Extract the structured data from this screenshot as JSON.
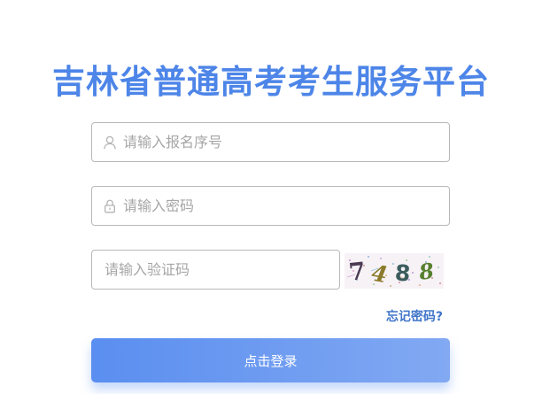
{
  "page": {
    "title": "吉林省普通高考考生服务平台"
  },
  "form": {
    "username": {
      "placeholder": "请输入报名序号",
      "value": "",
      "icon": "user-icon"
    },
    "password": {
      "placeholder": "请输入密码",
      "value": "",
      "icon": "lock-icon"
    },
    "captcha": {
      "placeholder": "请输入验证码",
      "value": "",
      "image_text": "7488"
    },
    "forgot_password_label": "忘记密码?",
    "submit_label": "点击登录"
  },
  "colors": {
    "title": "#4d85e8",
    "link": "#3f74c9",
    "button_start": "#5a8ef0",
    "button_end": "#82a9f2",
    "field_border": "#b8b8b8",
    "placeholder": "#a6a6a6"
  }
}
